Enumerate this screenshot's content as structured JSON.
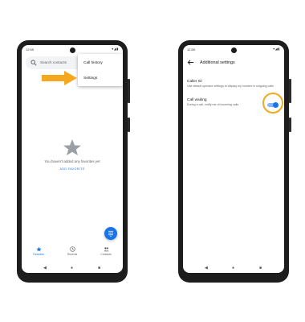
{
  "left_phone": {
    "status_time": "12:55",
    "status_icons": "▾◢▮",
    "search": {
      "placeholder": "Search contacts"
    },
    "menu": {
      "items": [
        "Call history",
        "Settings"
      ]
    },
    "empty_state": {
      "message": "You haven't added any favorites yet",
      "action": "ADD FAVORITE"
    },
    "tabs": [
      {
        "label": "Favorites",
        "icon": "star-icon",
        "active": true
      },
      {
        "label": "Recents",
        "icon": "clock-icon",
        "active": false
      },
      {
        "label": "Contacts",
        "icon": "people-icon",
        "active": false
      }
    ],
    "nav": {
      "back": "◀",
      "home": "●",
      "recents": "■"
    }
  },
  "right_phone": {
    "status_time": "12:55",
    "status_icons": "▾◢▮",
    "title": "Additional settings",
    "settings": [
      {
        "title": "Caller ID",
        "summary": "Use default operator settings to display my number in outgoing calls"
      },
      {
        "title": "Call waiting",
        "summary": "During a call, notify me of incoming calls",
        "enabled": true
      }
    ],
    "nav": {
      "back": "◀",
      "home": "●",
      "recents": "■"
    }
  },
  "colors": {
    "accent": "#1a73e8",
    "highlight": "#f4a81d",
    "phone_body": "#1d1d1d"
  }
}
